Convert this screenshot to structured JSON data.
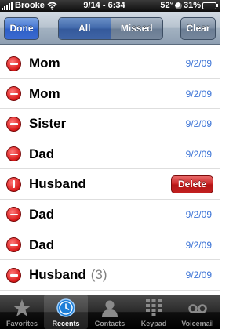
{
  "status_bar": {
    "carrier": "Brooke",
    "time": "9/14 - 6:34",
    "temperature": "52°",
    "battery": "31%",
    "battery_level": 0.31,
    "icons": [
      "signal-icon",
      "wifi-icon",
      "moon-icon",
      "battery-icon"
    ]
  },
  "nav": {
    "done_label": "Done",
    "segments": [
      "All",
      "Missed"
    ],
    "selected_segment": "All",
    "clear_label": "Clear"
  },
  "calls": [
    {
      "name": "Mom",
      "count": "",
      "date": "9/2/09",
      "delete_confirm": false
    },
    {
      "name": "Mom",
      "count": "",
      "date": "9/2/09",
      "delete_confirm": false
    },
    {
      "name": "Sister",
      "count": "",
      "date": "9/2/09",
      "delete_confirm": false
    },
    {
      "name": "Dad",
      "count": "",
      "date": "9/2/09",
      "delete_confirm": false
    },
    {
      "name": "Husband",
      "count": "",
      "date": "",
      "delete_confirm": true
    },
    {
      "name": "Dad",
      "count": "",
      "date": "9/2/09",
      "delete_confirm": false
    },
    {
      "name": "Dad",
      "count": "",
      "date": "9/2/09",
      "delete_confirm": false
    },
    {
      "name": "Husband",
      "count": "(3)",
      "date": "9/2/09",
      "delete_confirm": false
    }
  ],
  "delete_label": "Delete",
  "tabs": [
    {
      "label": "Favorites",
      "icon": "star-icon",
      "active": false
    },
    {
      "label": "Recents",
      "icon": "clock-icon",
      "active": true
    },
    {
      "label": "Contacts",
      "icon": "person-icon",
      "active": false
    },
    {
      "label": "Keypad",
      "icon": "keypad-icon",
      "active": false
    },
    {
      "label": "Voicemail",
      "icon": "voicemail-icon",
      "active": false
    }
  ],
  "colors": {
    "accent_blue": "#3b73d6",
    "delete_red": "#c81f1f",
    "battery_green": "#4fd24f"
  }
}
